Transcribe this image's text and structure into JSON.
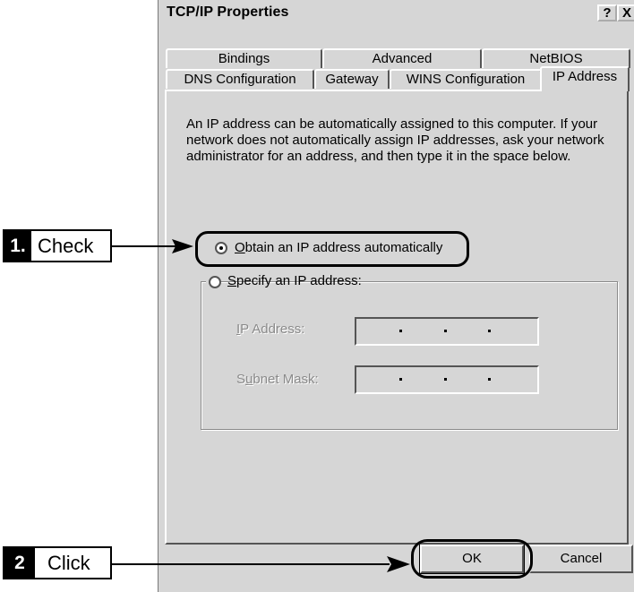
{
  "dialog": {
    "title": "TCP/IP Properties",
    "help_label": "?",
    "close_label": "X"
  },
  "tabs": {
    "back_row": [
      "Bindings",
      "Advanced",
      "NetBIOS"
    ],
    "front_row": [
      "DNS Configuration",
      "Gateway",
      "WINS Configuration"
    ],
    "active": "IP Address"
  },
  "content": {
    "description": "An IP address can be automatically assigned to this computer. If your network does not automatically assign IP addresses, ask your network administrator for an address, and then type it in the space below.",
    "obtain_radio": {
      "accel": "O",
      "label": "btain an IP address automatically",
      "selected": true
    },
    "specify_radio": {
      "accel": "S",
      "label": "pecify an IP address:",
      "selected": false
    },
    "ip_address_label": {
      "accel": "I",
      "label": "P Address:"
    },
    "subnet_label": {
      "pre": "S",
      "accel": "u",
      "label": "bnet Mask:"
    }
  },
  "buttons": {
    "ok": "OK",
    "cancel": "Cancel"
  },
  "annotations": {
    "step1": {
      "num": "1.",
      "text": "Check"
    },
    "step2": {
      "num": "2",
      "text": "Click"
    }
  }
}
